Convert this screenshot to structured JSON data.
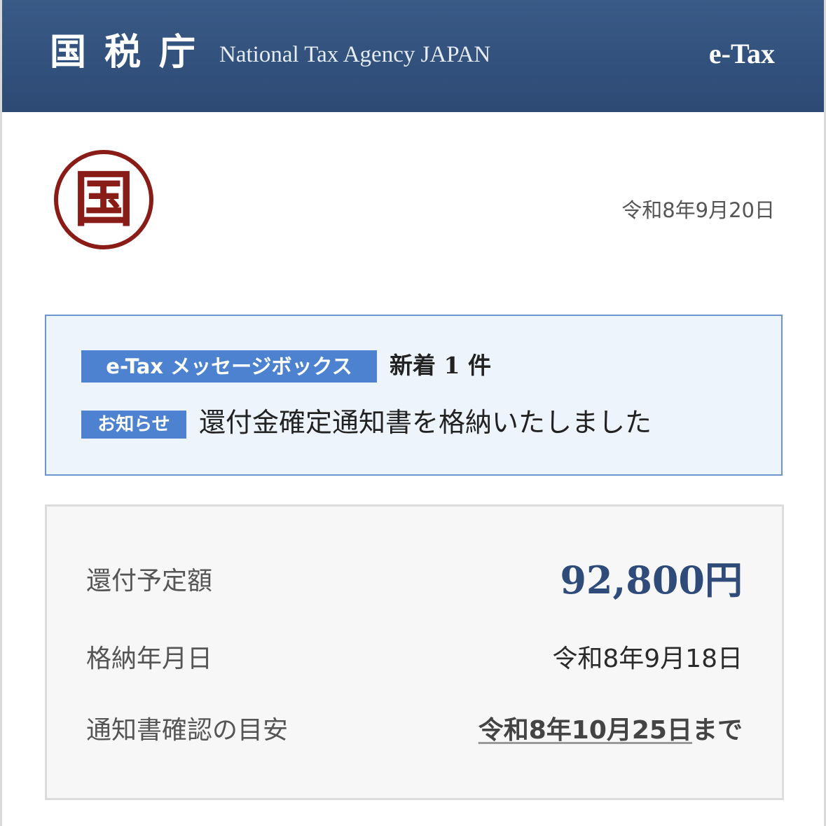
{
  "header": {
    "agency_name": "国税庁",
    "agency_subtitle": "National Tax Agency JAPAN",
    "service_name": "e-Tax",
    "background_color": "#2c4a74"
  },
  "seal": {
    "character": "国",
    "color": "#8a1c17"
  },
  "issue_date": "令和8年9月20日",
  "message_box": {
    "tag_label": "e-Tax メッセージボックス",
    "new_count_text": "新着 1 件",
    "notice_tag_label": "お知らせ",
    "notice_text": "還付金確定通知書を格納いたしました",
    "accent_color": "#4c82cf"
  },
  "details": {
    "rows": [
      {
        "label": "還付予定額",
        "value": "92,800円"
      },
      {
        "label": "格納年月日",
        "value": "令和8年9月18日"
      },
      {
        "label": "通知書確認の目安",
        "value": "令和8年10月25日",
        "suffix": "まで"
      }
    ],
    "amount_color": "#2e4b7a"
  }
}
